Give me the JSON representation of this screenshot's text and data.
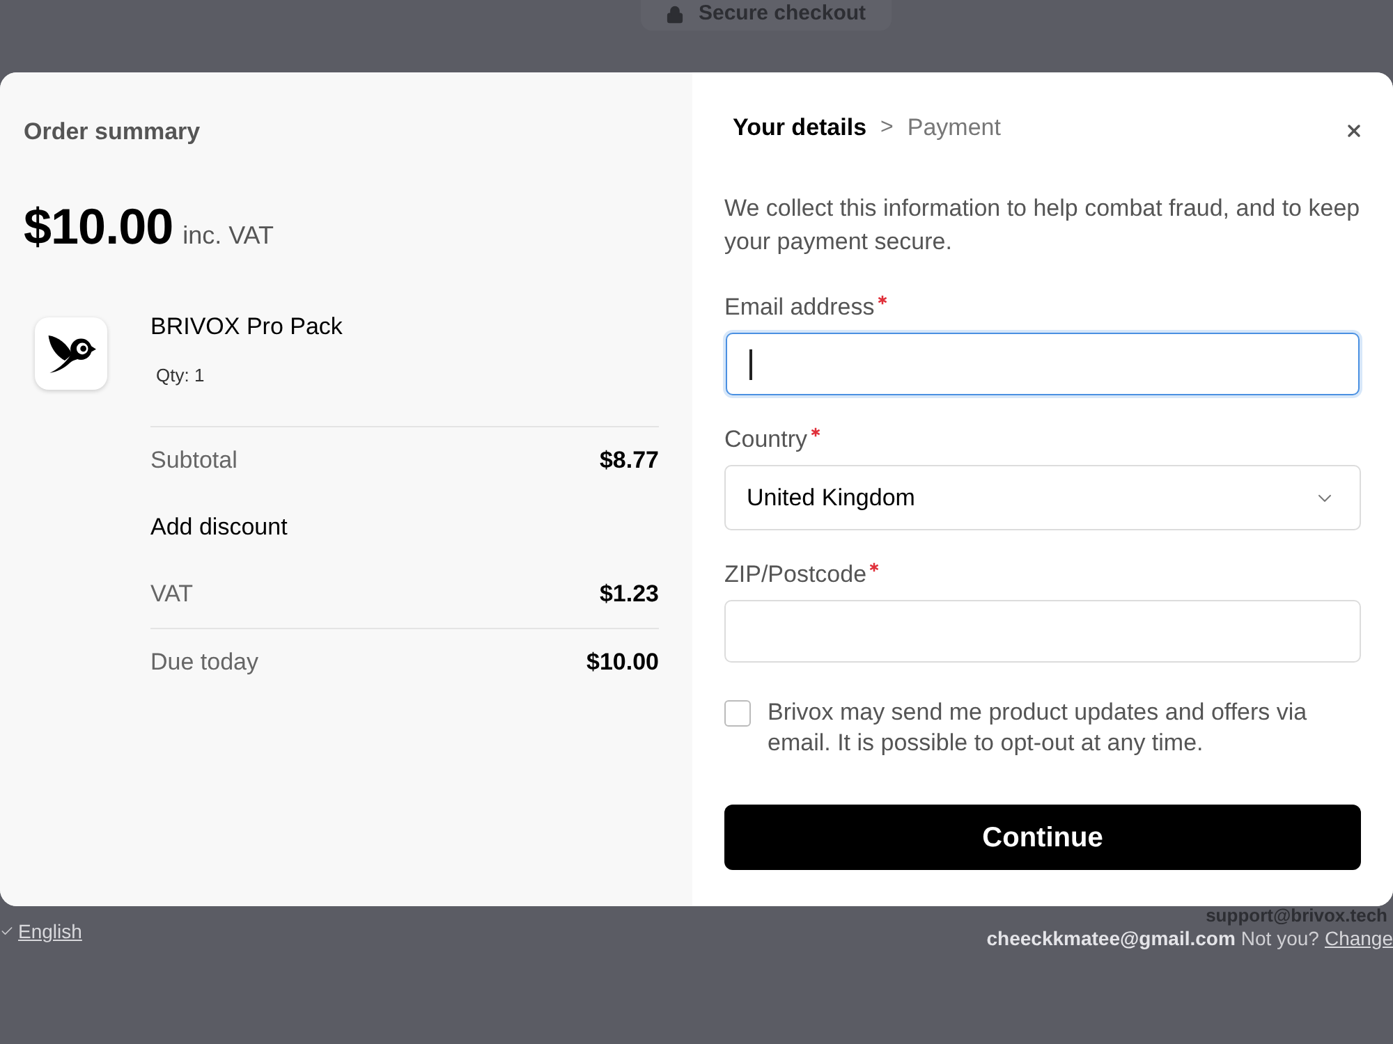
{
  "background_page": {
    "header": {
      "title": "Secure checkout"
    },
    "support_email": "support@brivox.tech",
    "footer": {
      "language": "English",
      "account_email": "cheeckkmatee@gmail.com",
      "account_prompt": "Not you?",
      "account_link": "Change"
    }
  },
  "order_summary": {
    "title": "Order summary",
    "total": "$10.00",
    "total_note": "inc. VAT",
    "product": {
      "name": "BRIVOX Pro Pack",
      "quantity": "Qty: 1"
    },
    "lines": [
      {
        "kind": "amount",
        "label": "Subtotal",
        "value": "$8.77"
      },
      {
        "kind": "link",
        "label": "Add discount"
      },
      {
        "kind": "amount",
        "label": "VAT",
        "value": "$1.23"
      },
      {
        "kind": "total",
        "label": "Due today",
        "value": "$10.00"
      }
    ]
  },
  "checkout": {
    "steps": [
      {
        "label": "Your details",
        "selected": true
      },
      {
        "label": "Payment",
        "selected": false
      }
    ],
    "step_separator": ">",
    "intro": "We collect this information to help combat fraud, and to keep your payment secure.",
    "fields": [
      {
        "kind": "text",
        "label": "Email address",
        "required": true,
        "focused": true
      },
      {
        "kind": "select",
        "label": "Country",
        "required": true,
        "value": "United Kingdom"
      },
      {
        "kind": "text",
        "label": "ZIP/Postcode",
        "required": true,
        "focused": false
      }
    ],
    "consent": {
      "text": "Brivox may send me product updates and offers via email. It is possible to opt-out at any time.",
      "checked": false
    },
    "submit": "Continue"
  }
}
